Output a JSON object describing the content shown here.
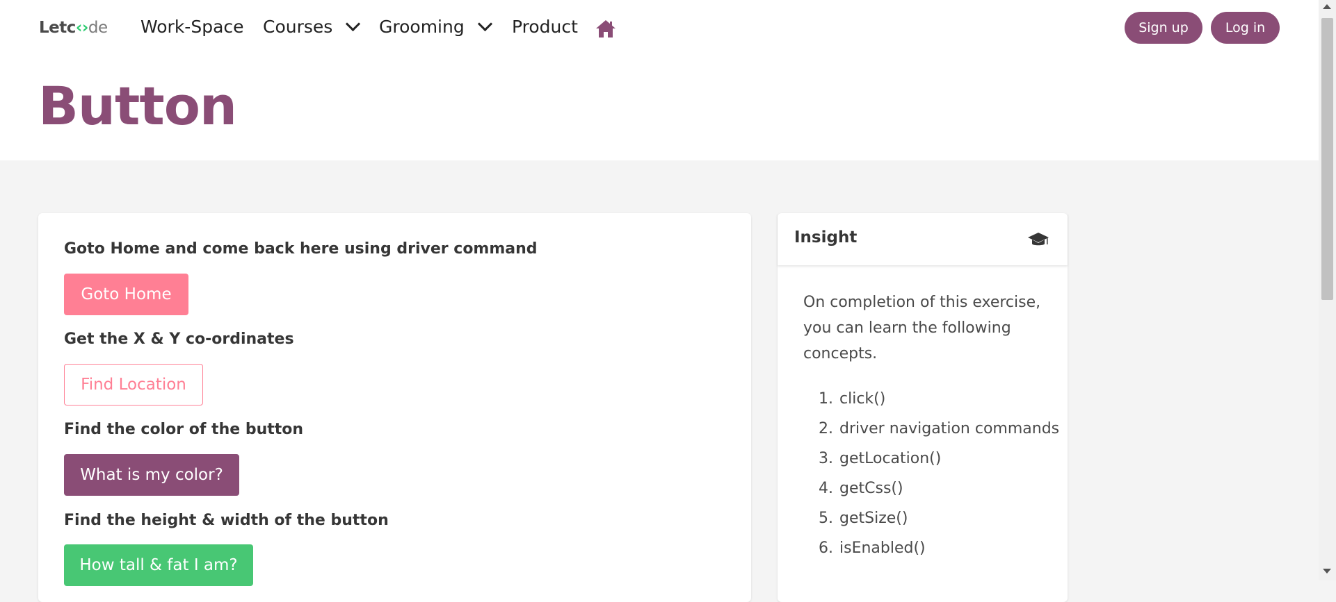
{
  "nav": {
    "logo": {
      "part1": "Let",
      "part2": "c",
      "part3": "‹›",
      "part4": "de"
    },
    "items": [
      "Work-Space",
      "Courses",
      "Grooming",
      "Product"
    ],
    "signup": "Sign up",
    "login": "Log in"
  },
  "page": {
    "title": "Button"
  },
  "exercises": [
    {
      "label": "Goto Home and come back here using driver command",
      "button": "Goto Home"
    },
    {
      "label": "Get the X & Y co-ordinates",
      "button": "Find Location"
    },
    {
      "label": "Find the color of the button",
      "button": "What is my color?"
    },
    {
      "label": "Find the height & width of the button",
      "button": "How tall & fat I am?"
    }
  ],
  "insight": {
    "title": "Insight",
    "intro": "On completion of this exercise, you can learn the following concepts.",
    "items": [
      "click()",
      "driver navigation commands",
      "getLocation()",
      "getCss()",
      "getSize()",
      "isEnabled()"
    ]
  },
  "colors": {
    "brand": "#8a4d76",
    "pink": "#ff7f94",
    "green": "#48c774",
    "background": "#f4f4f4"
  }
}
